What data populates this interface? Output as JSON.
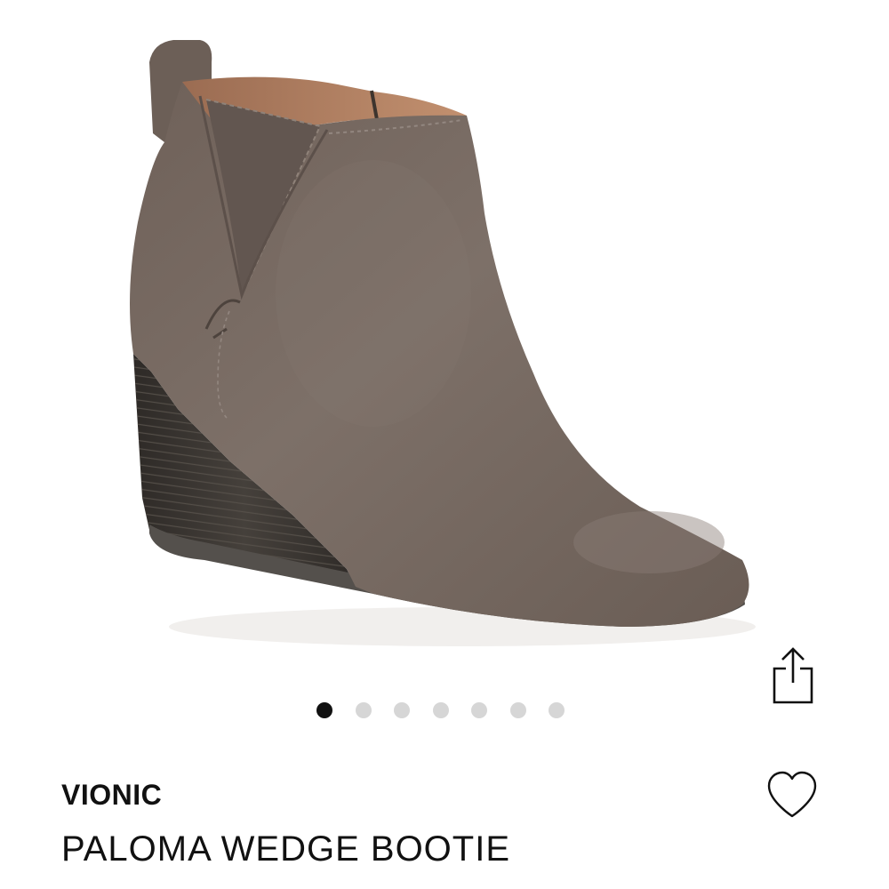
{
  "product": {
    "image_icon": "wedge-ankle-bootie-photo",
    "brand": "VIONIC",
    "name": "PALOMA WEDGE BOOTIE",
    "colors": {
      "suede": "#786b63",
      "wedge": "#3b3632",
      "lining": "#b58466"
    }
  },
  "carousel": {
    "total": 7,
    "active_index": 0,
    "dots": [
      {
        "label": "1"
      },
      {
        "label": "2"
      },
      {
        "label": "3"
      },
      {
        "label": "4"
      },
      {
        "label": "5"
      },
      {
        "label": "6"
      },
      {
        "label": "7"
      }
    ]
  },
  "actions": {
    "share_icon": "share-icon",
    "favorite_icon": "heart-icon"
  }
}
